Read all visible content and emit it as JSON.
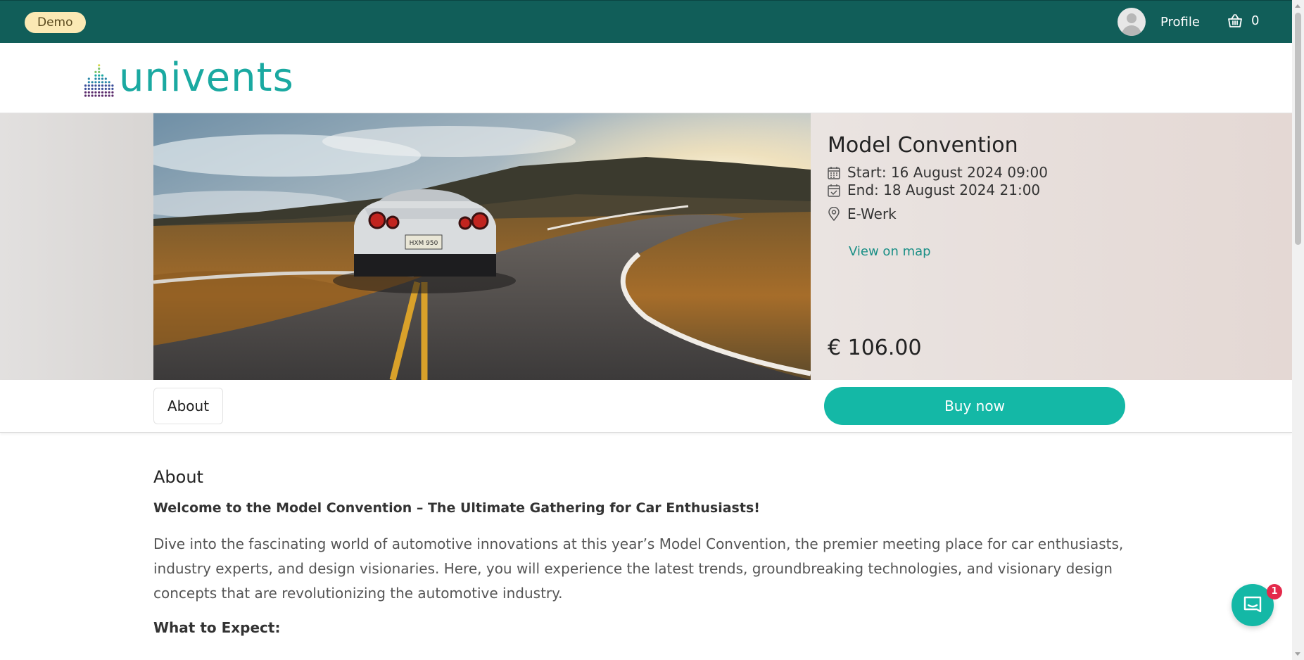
{
  "topbar": {
    "demo_label": "Demo",
    "profile_label": "Profile",
    "cart_count": "0"
  },
  "brand": {
    "name": "univents",
    "accent_color": "#1aa9a1",
    "topbar_color": "#115e59",
    "button_color": "#14b8a6"
  },
  "event": {
    "title": "Model Convention",
    "start": "Start: 16 August 2024 09:00",
    "end": "End: 18 August 2024 21:00",
    "venue": "E-Werk",
    "map_link": "View on map",
    "price": "€ 106.00",
    "image_plate": "HXM 950"
  },
  "actions": {
    "about_tab": "About",
    "buy_button": "Buy now"
  },
  "content": {
    "heading": "About",
    "intro": "Welcome to the Model Convention – The Ultimate Gathering for Car Enthusiasts!",
    "paragraph": "Dive into the fascinating world of automotive innovations at this year’s Model Convention, the premier meeting place for car enthusiasts, industry experts, and design visionaries. Here, you will experience the latest trends, groundbreaking technologies, and visionary design concepts that are revolutionizing the automotive industry.",
    "expect_heading": "What to Expect:"
  },
  "chat": {
    "badge_count": "1"
  },
  "icons": [
    "calendar-icon",
    "calendar-check-icon",
    "map-pin-icon",
    "basket-icon",
    "chat-icon",
    "user-avatar-icon"
  ]
}
